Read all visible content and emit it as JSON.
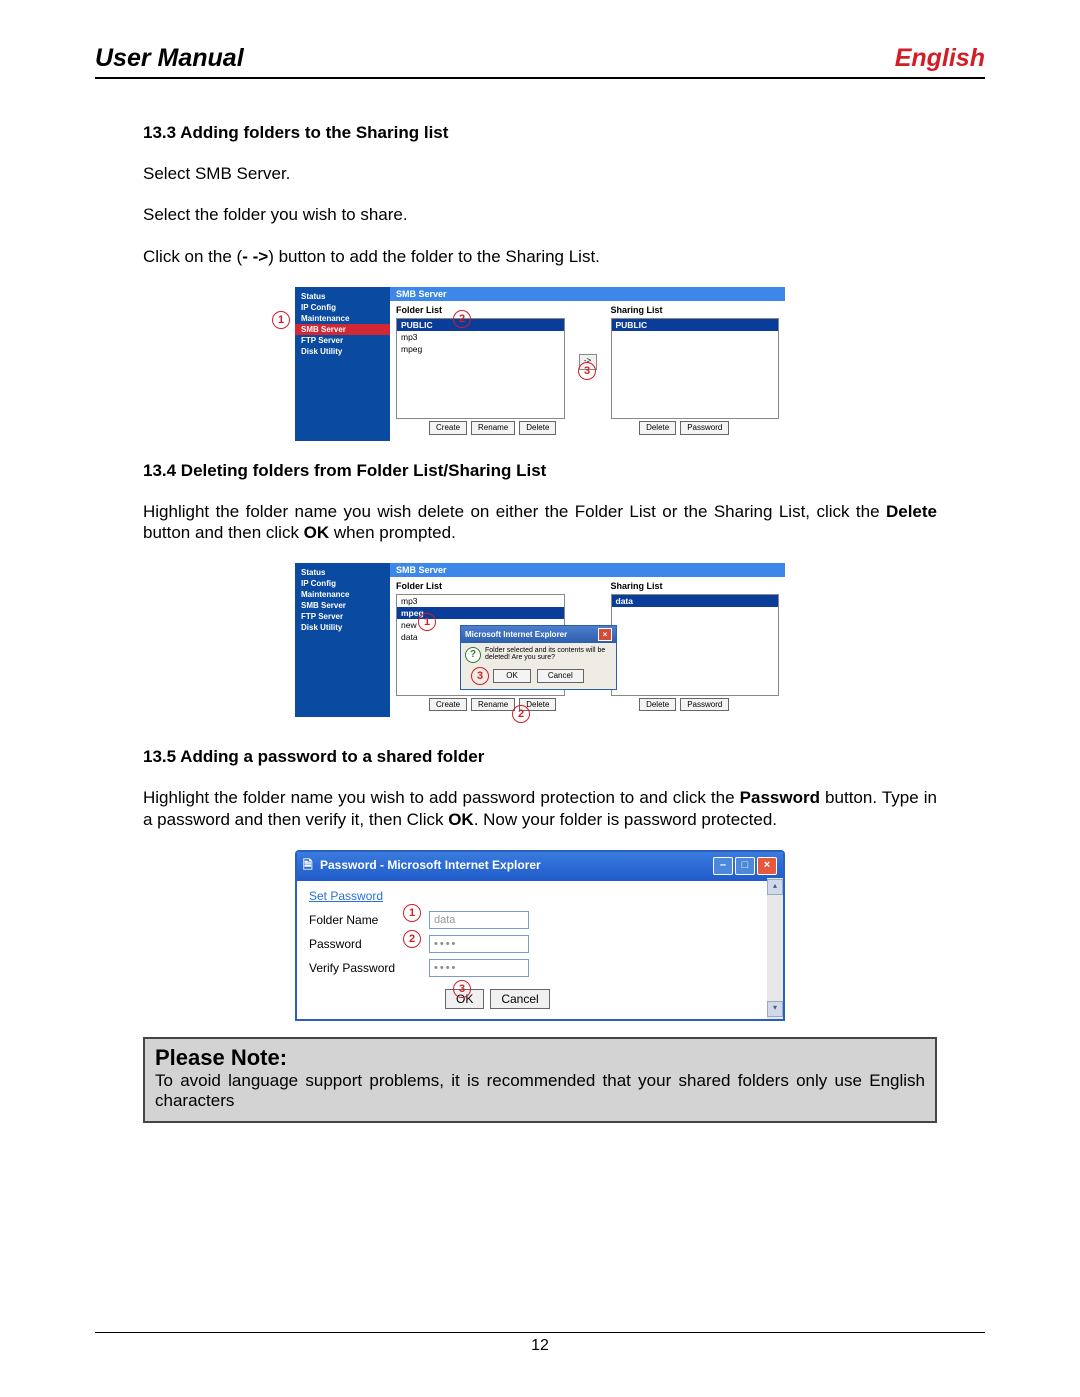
{
  "header": {
    "left": "User Manual",
    "right": "English"
  },
  "page_number": "12",
  "s133": {
    "heading": "13.3 Adding folders to the Sharing list",
    "p1": "Select SMB Server.",
    "p2": "Select the folder you wish to share.",
    "p3a": "Click on the (",
    "p3b": "- ->",
    "p3c": ") button to add the folder to the Sharing List."
  },
  "smb1": {
    "side": [
      "Status",
      "IP Config",
      "Maintenance",
      "SMB Server",
      "FTP Server",
      "Disk Utility"
    ],
    "title": "SMB Server",
    "folder_list_label": "Folder List",
    "sharing_list_label": "Sharing List",
    "folder_items": [
      "PUBLIC",
      "mp3",
      "mpeg"
    ],
    "sharing_items": [
      "PUBLIC"
    ],
    "arrow": "->",
    "btns_left": [
      "Create",
      "Rename",
      "Delete"
    ],
    "btns_right": [
      "Delete",
      "Password"
    ],
    "ann": {
      "a1": "1",
      "a2": "2",
      "a3": "3"
    }
  },
  "s134": {
    "heading": "13.4 Deleting folders from Folder List/Sharing List",
    "p1a": "Highlight the folder name you wish delete on either the Folder List or the Sharing List, click the ",
    "p1b": "Delete",
    "p1c": " button and then click ",
    "p1d": "OK",
    "p1e": " when prompted."
  },
  "smb2": {
    "side": [
      "Status",
      "IP Config",
      "Maintenance",
      "SMB Server",
      "FTP Server",
      "Disk Utility"
    ],
    "title": "SMB Server",
    "folder_list_label": "Folder List",
    "sharing_list_label": "Sharing List",
    "folder_items": [
      "mp3",
      "mpeg",
      "new",
      "data"
    ],
    "sharing_items": [
      "data"
    ],
    "btns_left": [
      "Create",
      "Rename",
      "Delete"
    ],
    "btns_right": [
      "Delete",
      "Password"
    ],
    "dialog": {
      "title": "Microsoft Internet Explorer",
      "msg": "Folder selected and its contents will be deleted! Are you sure?",
      "ok": "OK",
      "cancel": "Cancel"
    },
    "ann": {
      "a1": "1",
      "a2": "2",
      "a3": "3"
    }
  },
  "s135": {
    "heading": "13.5 Adding a password to a shared folder",
    "p1a": "Highlight the folder name you wish to add password protection to and click the ",
    "p1b": "Password",
    "p1c": " button. Type in a password and then verify it, then Click ",
    "p1d": "OK",
    "p1e": ". Now your folder is password protected."
  },
  "pwd": {
    "title": "Password - Microsoft Internet Explorer",
    "section": "Set Password",
    "rows": {
      "folder_label": "Folder Name",
      "folder_value": "data",
      "pwd_label": "Password",
      "pwd_value": "••••",
      "verify_label": "Verify Password",
      "verify_value": "••••"
    },
    "ok": "OK",
    "cancel": "Cancel",
    "min": "–",
    "max": "□",
    "close": "×",
    "ann": {
      "a1": "1",
      "a2": "2",
      "a3": "3"
    }
  },
  "note": {
    "title": "Please Note:",
    "body": "To avoid language support problems, it is recommended that your shared folders only use English characters"
  }
}
